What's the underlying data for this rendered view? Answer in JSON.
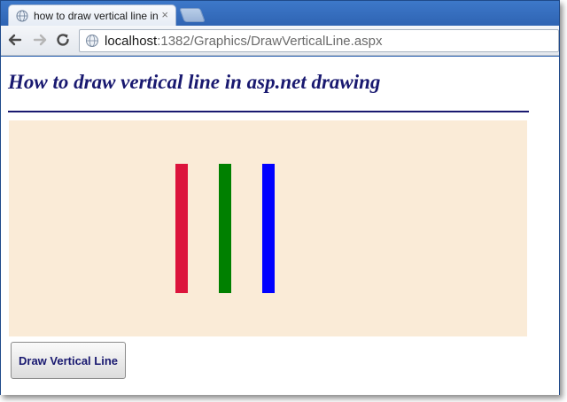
{
  "browser": {
    "tab_title": "how to draw vertical line in",
    "tab_close": "×",
    "url_host": "localhost",
    "url_path": ":1382/Graphics/DrawVerticalLine.aspx"
  },
  "page": {
    "heading": "How to draw vertical line in asp.net drawing",
    "button_label": "Draw Vertical Line"
  },
  "drawing": {
    "background": "#faebd7",
    "lines": [
      {
        "color": "#dc143c"
      },
      {
        "color": "#008000"
      },
      {
        "color": "#0000ff"
      }
    ]
  },
  "colors": {
    "heading": "#191970",
    "rule": "#191970"
  }
}
